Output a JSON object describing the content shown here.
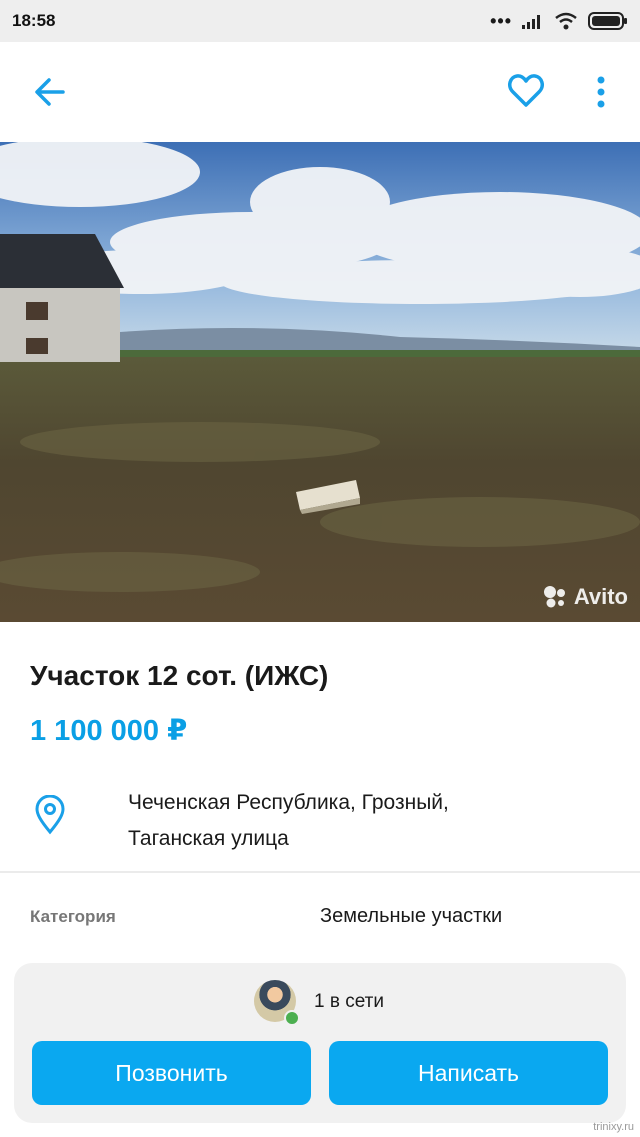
{
  "status_bar": {
    "time": "18:58"
  },
  "listing": {
    "title": "Участок 12 сот. (ИЖС)",
    "price": "1 100 000 ₽",
    "address_line1": "Чеченская Республика, Грозный,",
    "address_line2": "Таганская улица",
    "photo_watermark": "Avito"
  },
  "details": {
    "category_label": "Категория",
    "category_value": "Земельные участки"
  },
  "seller": {
    "online_status": "1 в сети"
  },
  "actions": {
    "call_label": "Позвонить",
    "write_label": "Написать"
  },
  "site_watermark": "trinixy.ru",
  "colors": {
    "accent": "#0aa8f0",
    "price": "#0a9fe5",
    "icon_blue": "#1aa0e8"
  }
}
